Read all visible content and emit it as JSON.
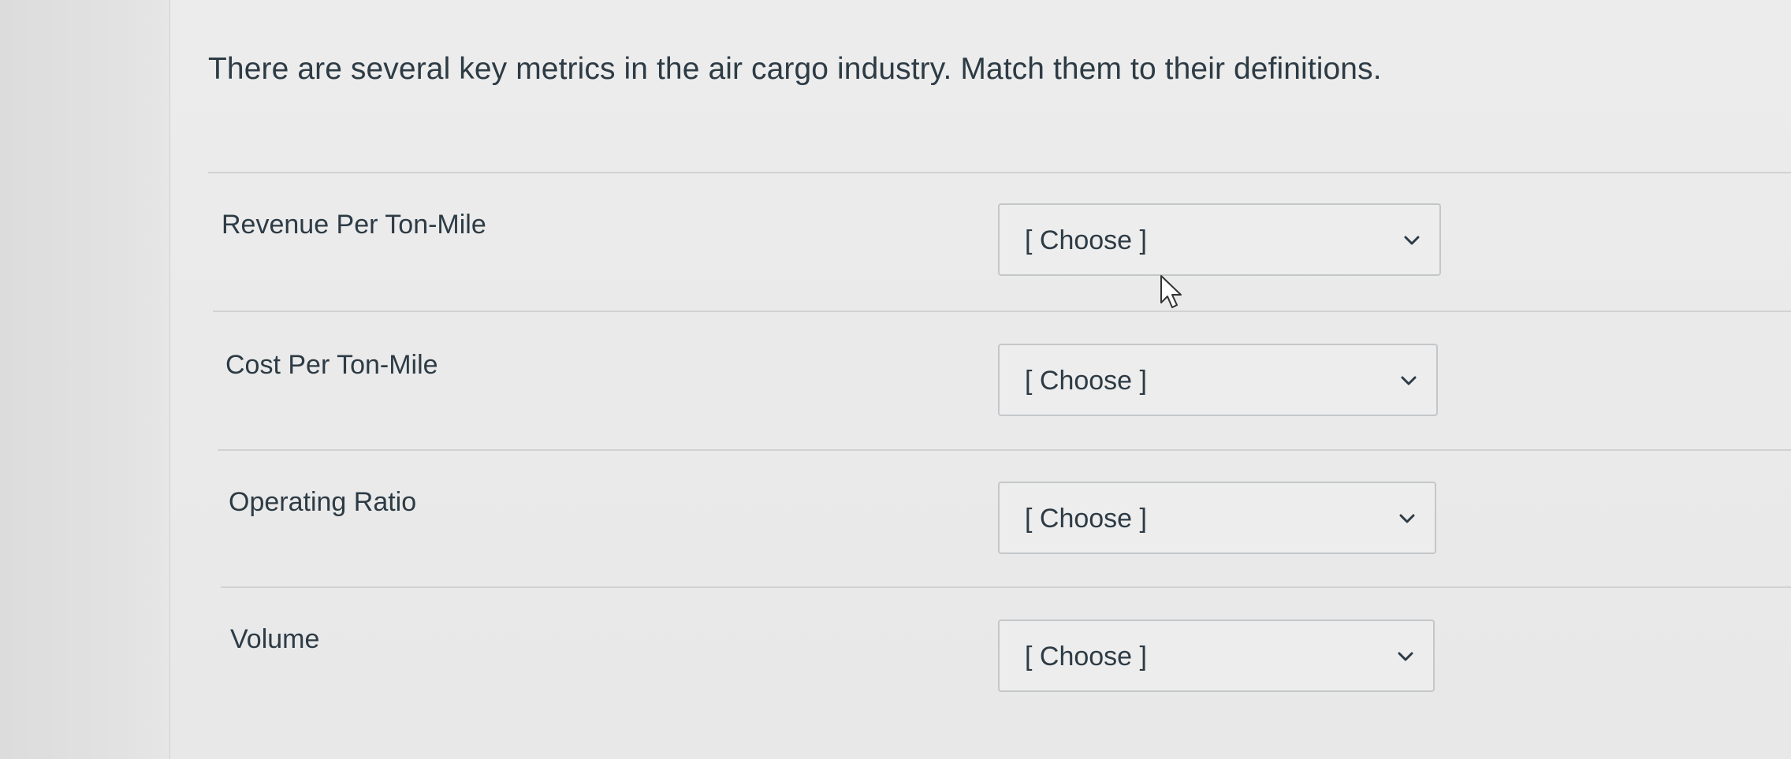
{
  "question": {
    "prompt": "There are several key metrics in the air cargo industry. Match them to their definitions."
  },
  "rows": [
    {
      "label": "Revenue Per Ton-Mile",
      "select_value": "[ Choose ]"
    },
    {
      "label": "Cost Per Ton-Mile",
      "select_value": "[ Choose ]"
    },
    {
      "label": "Operating Ratio",
      "select_value": "[ Choose ]"
    },
    {
      "label": "Volume",
      "select_value": "[ Choose ]"
    }
  ],
  "icons": {
    "dropdown": "chevron-down-icon",
    "pointer": "mouse-cursor-icon"
  },
  "colors": {
    "text": "#2d3b45",
    "border": "#c4c7c9",
    "background": "#e8e8e8"
  }
}
